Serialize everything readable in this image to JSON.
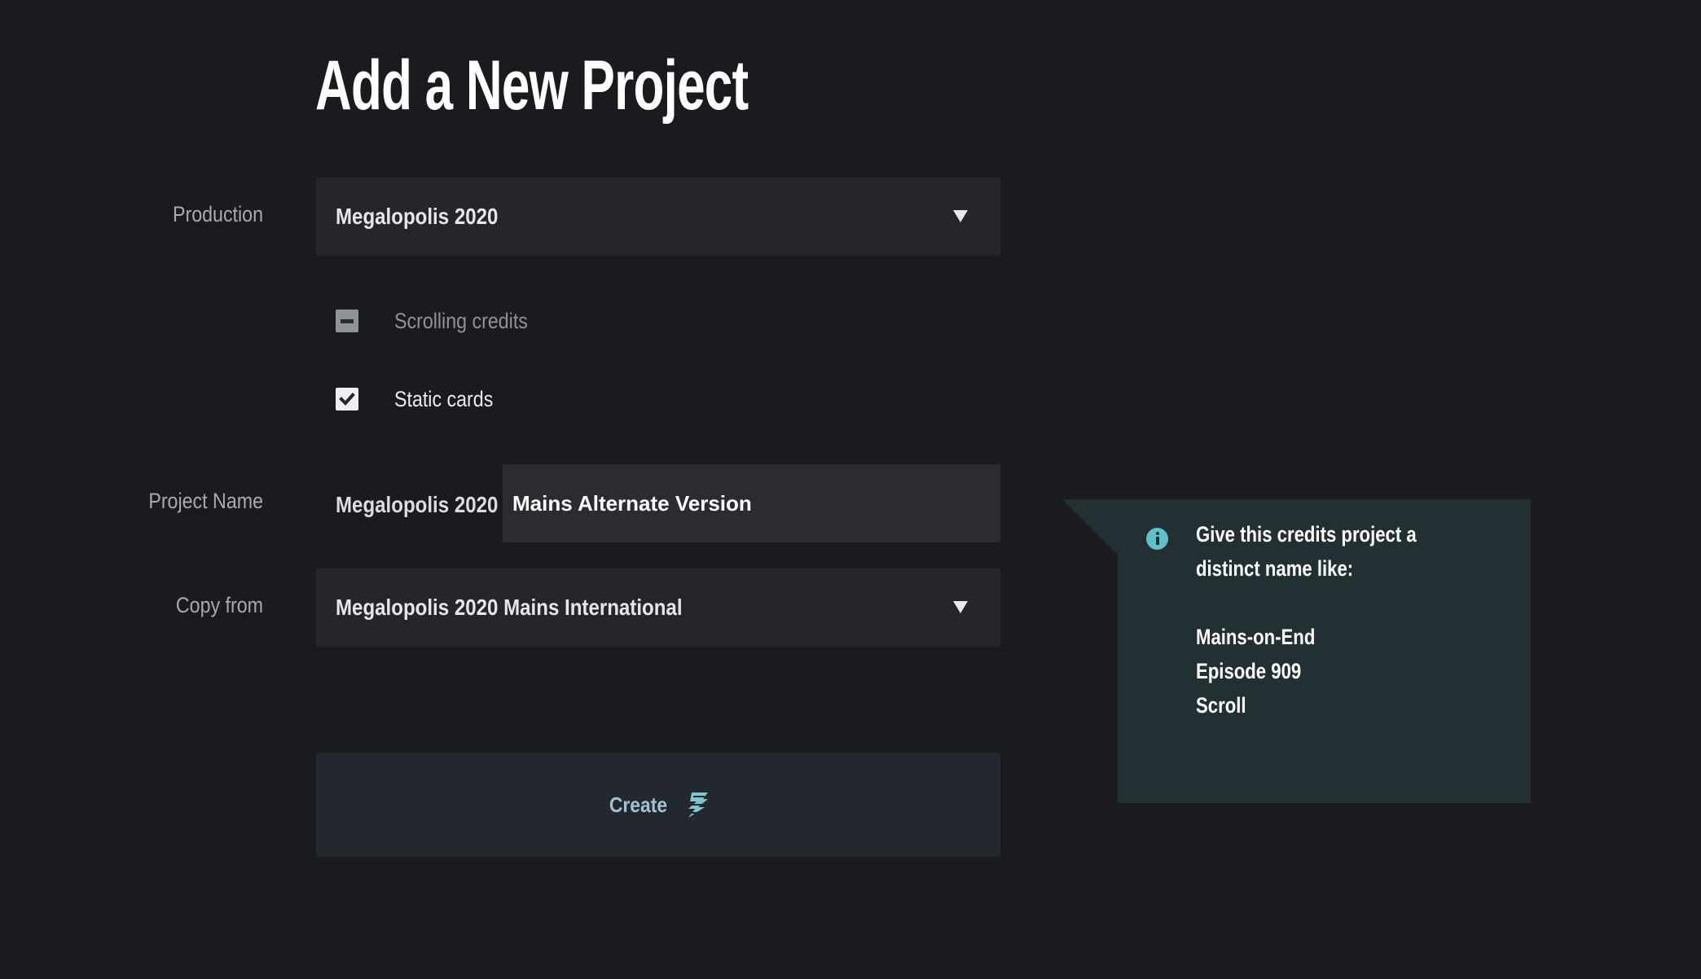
{
  "page": {
    "title": "Add a New Project"
  },
  "form": {
    "production": {
      "label": "Production",
      "selected": "Megalopolis 2020"
    },
    "credit_types": [
      {
        "label": "Scrolling credits",
        "state": "indeterminate"
      },
      {
        "label": "Static cards",
        "state": "checked"
      }
    ],
    "project_name": {
      "label": "Project Name",
      "prefix": "Megalopolis 2020",
      "value": "Mains Alternate Version"
    },
    "copy_from": {
      "label": "Copy from",
      "selected": "Megalopolis 2020 Mains International"
    },
    "create_button": {
      "label": "Create",
      "icon": "lightning-bolt-icon"
    }
  },
  "info_panel": {
    "icon": "info-icon",
    "intro_lines": [
      "Give this credits project a",
      "distinct name like:"
    ],
    "examples": [
      "Mains-on-End",
      "Episode 909",
      "Scroll"
    ]
  },
  "colors": {
    "background": "#1a1b1f",
    "field": "#24262b",
    "info_panel": "#223033",
    "accent": "#5fc1c9",
    "button_text": "#9ec3cf"
  }
}
